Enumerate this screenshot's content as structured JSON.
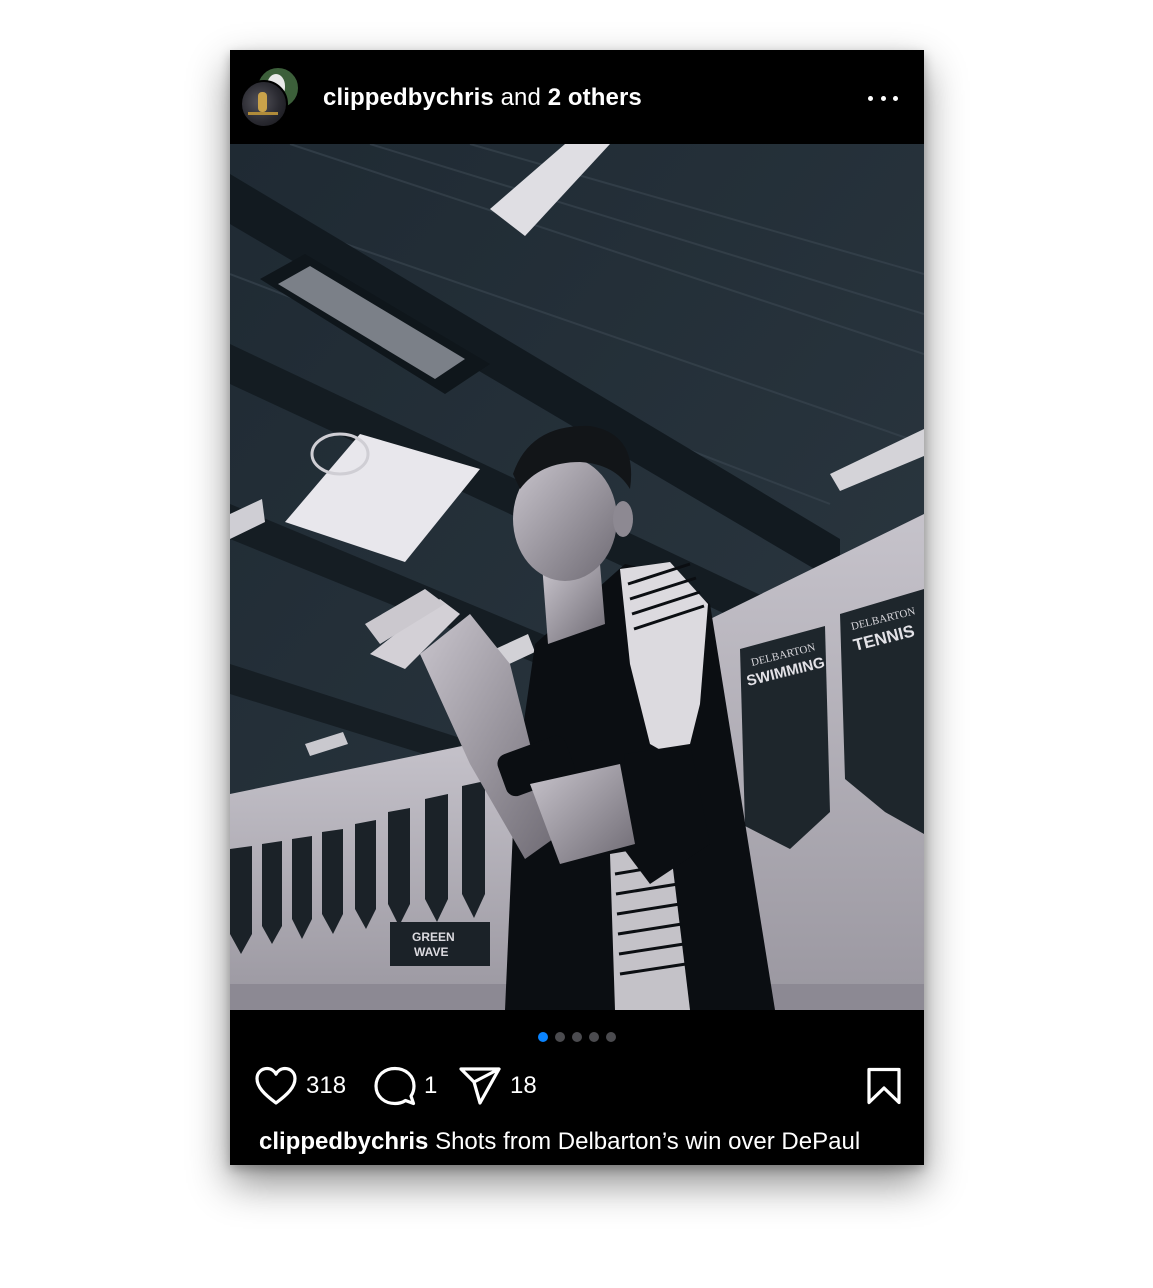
{
  "post": {
    "header": {
      "username": "clippedbychris",
      "collab_joiner": "and",
      "collab_others": "2 others",
      "more_icon": "more-horizontal-icon"
    },
    "carousel": {
      "count": 5,
      "active_index": 0,
      "active_color": "#0a84ff"
    },
    "actions": {
      "likes": "318",
      "comments": "1",
      "shares": "18",
      "icons": [
        "heart-icon",
        "comment-icon",
        "share-icon",
        "bookmark-icon"
      ]
    },
    "caption": {
      "username": "clippedbychris",
      "text": "Shots from Delbarton’s win over DePaul"
    }
  },
  "photo": {
    "banner_1_title": "DELBARTON",
    "banner_1_subtitle": "SWIMMING",
    "banner_2_title": "DELBARTON",
    "banner_2_subtitle": "TENNIS",
    "sign_line_1": "GREEN",
    "sign_line_2": "WAVE"
  }
}
